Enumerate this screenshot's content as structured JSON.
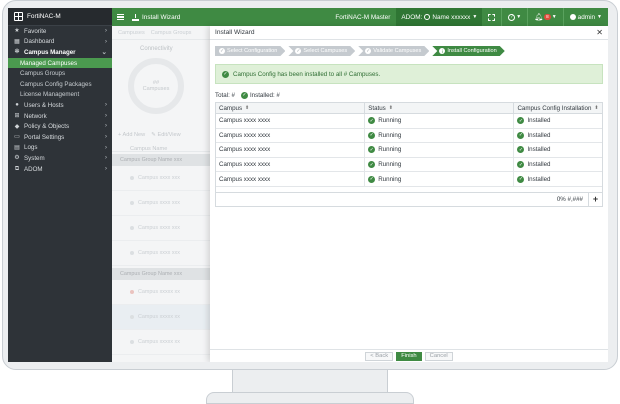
{
  "sidebar": {
    "brand": "FortiNAC-M",
    "items": [
      {
        "label": "Favorite",
        "icon": "star-icon",
        "glyph": "★"
      },
      {
        "label": "Dashboard",
        "icon": "dashboard-icon",
        "glyph": "▦"
      },
      {
        "label": "Campus Manager",
        "icon": "gear-icon",
        "glyph": "✲"
      },
      {
        "label": "Users & Hosts",
        "icon": "users-icon",
        "glyph": "●"
      },
      {
        "label": "Network",
        "icon": "network-icon",
        "glyph": "⊞"
      },
      {
        "label": "Policy & Objects",
        "icon": "policy-icon",
        "glyph": "◆"
      },
      {
        "label": "Portal Settings",
        "icon": "portal-icon",
        "glyph": "▭"
      },
      {
        "label": "Logs",
        "icon": "logs-icon",
        "glyph": "▤"
      },
      {
        "label": "System",
        "icon": "system-icon",
        "glyph": "⚙"
      },
      {
        "label": "ADOM",
        "icon": "adom-icon",
        "glyph": "⧉"
      }
    ],
    "sub_items": [
      "Managed Campuses",
      "Campus Groups",
      "Campus Config Packages",
      "License Management"
    ]
  },
  "topbar": {
    "wizard_label": "Install Wizard",
    "product": "FortiNAC-M Master",
    "adom_label": "ADOM:",
    "adom_name": "Name xxxxxx",
    "notification_count": "8",
    "user": "admin"
  },
  "background": {
    "tabs": [
      "Campuses",
      "Campus Groups"
    ],
    "donut_title": "Connectivity",
    "donut_value": "##",
    "donut_caption": "Campuses",
    "add_label": "+ Add New",
    "edit_label": "✎ Edit/View",
    "col_name": "Campus Name",
    "group1": "Campus Group Name xxx",
    "group2": "Campus Group Name xxx",
    "rows_a": [
      "Campus xxxx xxx",
      "Campus xxxx xxx",
      "Campus xxxx xxx",
      "Campus xxxx xxx"
    ],
    "rows_b": [
      "Campus xxxxx xx",
      "Campus xxxxx xx",
      "Campus xxxxx xx"
    ]
  },
  "wizard": {
    "title": "Install Wizard",
    "steps": [
      "Select Configuration",
      "Select Campuses",
      "Validate Campuses",
      "Install Configuration"
    ],
    "success_message": "Campus Config has been installed to all # Campuses.",
    "total_label": "Total: #",
    "installed_label": "Installed: #",
    "columns": [
      "Campus",
      "Status",
      "Campus Config Installation"
    ],
    "rows": [
      {
        "campus": "Campus xxxx xxxx",
        "status": "Running",
        "install": "Installed"
      },
      {
        "campus": "Campus xxxx xxxx",
        "status": "Running",
        "install": "Installed"
      },
      {
        "campus": "Campus xxxx xxxx",
        "status": "Running",
        "install": "Installed"
      },
      {
        "campus": "Campus xxxx xxxx",
        "status": "Running",
        "install": "Installed"
      },
      {
        "campus": "Campus xxxx xxxx",
        "status": "Running",
        "install": "Installed"
      }
    ],
    "progress": "0% #,###",
    "buttons": {
      "back": "< Back",
      "finish": "Finish",
      "cancel": "Cancel"
    }
  },
  "colors": {
    "accent": "#3f8a43",
    "sidebar": "#2e3338",
    "success_bg": "#dff0d8"
  }
}
